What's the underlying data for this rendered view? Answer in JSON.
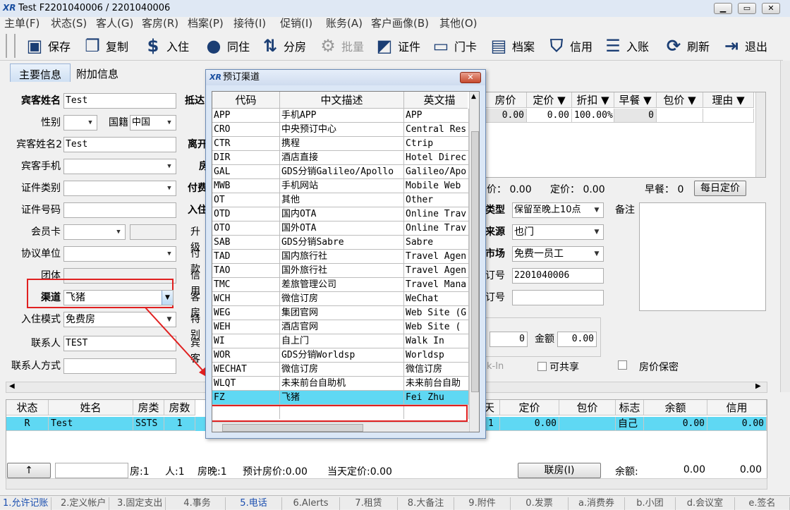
{
  "window": {
    "title": "Test  F2201040006 / 2201040006"
  },
  "menu": [
    "主单(F)",
    "状态(S)",
    "客人(G)",
    "客房(R)",
    "档案(P)",
    "接待(I)",
    "促销(I)",
    "账务(A)",
    "客户画像(B)",
    "其他(O)"
  ],
  "toolbar": [
    {
      "label": "保存",
      "icon": "save-icon"
    },
    {
      "label": "复制",
      "icon": "copy-icon"
    },
    {
      "label": "入住",
      "icon": "money-bag-icon"
    },
    {
      "label": "同住",
      "icon": "person-icon"
    },
    {
      "label": "分房",
      "icon": "split-room-icon"
    },
    {
      "label": "批量",
      "icon": "gear-icon",
      "disabled": true
    },
    {
      "label": "证件",
      "icon": "id-card-icon"
    },
    {
      "label": "门卡",
      "icon": "door-card-icon"
    },
    {
      "label": "档案",
      "icon": "profile-icon"
    },
    {
      "label": "信用",
      "icon": "shield-icon"
    },
    {
      "label": "入账",
      "icon": "posting-icon"
    },
    {
      "label": "刷新",
      "icon": "refresh-icon"
    },
    {
      "label": "退出",
      "icon": "exit-icon"
    }
  ],
  "tabs": [
    "主要信息",
    "附加信息"
  ],
  "form": {
    "guest_name_label": "宾客姓名",
    "guest_name": "Test",
    "gender_label": "性别",
    "nationality_label": "国籍",
    "nationality": "中国",
    "guest_name2_label": "宾客姓名2",
    "guest_name2": "Test",
    "mobile_label": "宾客手机",
    "id_type_label": "证件类别",
    "id_no_label": "证件号码",
    "member_card_label": "会员卡",
    "company_label": "协议单位",
    "group_label": "团体",
    "channel_label": "渠道",
    "channel": "飞猪",
    "checkin_mode_label": "入住模式",
    "checkin_mode": "免费房",
    "contact_label": "联系人",
    "contact": "TEST",
    "contact_method_label": "联系人方式",
    "arrival_label": "抵达",
    "departure_label": "离开",
    "room_label": "房",
    "payment_label": "付费",
    "checkin_label": "入住",
    "upgrade_label": "升级",
    "pay_label": "付款",
    "credit_label": "信用",
    "guest_type_label": "客房",
    "special_label": "特别",
    "guest_label": "宾客"
  },
  "rate_grid": {
    "headers": [
      "房价",
      "定价 ▼",
      "折扣 ▼",
      "早餐 ▼",
      "包价 ▼",
      "理由 ▼"
    ],
    "row": [
      "0.00",
      "0.00",
      "100.00%",
      "0",
      "",
      ""
    ]
  },
  "summary": {
    "price_label": "价：",
    "price": "0.00",
    "rack_label": "定价：",
    "rack": "0.00",
    "breakfast_label": "早餐：",
    "breakfast": "0",
    "daily_rate_button": "每日定价"
  },
  "right_form": {
    "type_label": "类型",
    "type": "保留至晚上10点",
    "source_label": "来源",
    "source": "也门",
    "market_label": "市场",
    "market": "免费一员工",
    "order_no_label": "订号",
    "order_no": "2201040006",
    "order_no2_label": "订号",
    "remarks_label": "备注",
    "amount_value": "0",
    "amount_label": "金额",
    "amount": "0.00",
    "shareable_label": "可共享",
    "rate_secret_label": "房价保密",
    "checkin_short": "k-In"
  },
  "dialog": {
    "title": "预订渠道",
    "headers": [
      "代码",
      "中文描述",
      "英文描"
    ],
    "rows": [
      [
        "APP",
        "手机APP",
        "APP"
      ],
      [
        "CRO",
        "中央预订中心",
        "Central Res"
      ],
      [
        "CTR",
        "携程",
        "Ctrip"
      ],
      [
        "DIR",
        "酒店直接",
        "Hotel Direc"
      ],
      [
        "GAL",
        "GDS分销Galileo/Apollo",
        "Galileo/Apo"
      ],
      [
        "MWB",
        "手机网站",
        "Mobile Web"
      ],
      [
        "OT",
        "其他",
        "Other"
      ],
      [
        "OTD",
        "国内OTA",
        "Online Trav"
      ],
      [
        "OTO",
        "国外OTA",
        "Online Trav"
      ],
      [
        "SAB",
        "GDS分销Sabre",
        "Sabre"
      ],
      [
        "TAD",
        "国内旅行社",
        "Travel Agen"
      ],
      [
        "TAO",
        "国外旅行社",
        "Travel Agen"
      ],
      [
        "TMC",
        "差旅管理公司",
        "Travel Mana"
      ],
      [
        "WCH",
        "微信订房",
        "WeChat"
      ],
      [
        "WEG",
        "集团官网",
        "Web Site (G"
      ],
      [
        "WEH",
        "酒店官网",
        "Web Site  ("
      ],
      [
        "WI",
        "自上门",
        "Walk In"
      ],
      [
        "WOR",
        "GDS分销Worldsp",
        "Worldsp"
      ],
      [
        "WECHAT",
        "微信订房",
        "微信订房"
      ],
      [
        "WLQT",
        "未来前台自助机",
        "未来前台自助"
      ],
      [
        "FZ",
        "飞猪",
        "Fei Zhu"
      ]
    ],
    "selected_index": 20
  },
  "bottom_grid": {
    "headers": [
      "状态",
      "姓名",
      "房类",
      "房数",
      "天",
      "定价",
      "包价",
      "标志",
      "余额",
      "信用"
    ],
    "row": [
      "R",
      "Test",
      "SSTS",
      "1",
      "1",
      "0.00",
      "",
      "自己",
      "0.00",
      "0.00"
    ]
  },
  "footer": {
    "up_button": "↑",
    "rooms": "房:1",
    "people": "人:1",
    "room_nights": "房晚:1",
    "forecast": "预计房价:0.00",
    "today_rate": "当天定价:0.00",
    "link_button": "联房(I)",
    "balance_label": "余额:",
    "balance": "0.00",
    "balance2": "0.00"
  },
  "statusbar": [
    "1.允许记账",
    "2.定义帐户",
    "3.固定支出",
    "4.事务",
    "5.电话",
    "6.Alerts",
    "7.租赁",
    "8.大备注",
    "9.附件",
    "0.发票",
    "a.消费券",
    "b.小团",
    "d.会议室",
    "e.签名"
  ]
}
